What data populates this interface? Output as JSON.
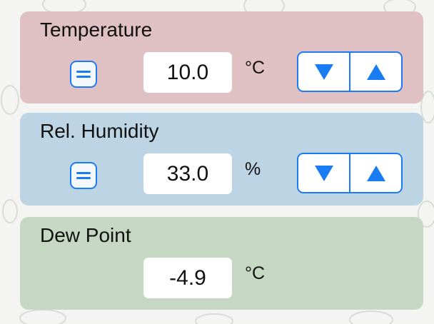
{
  "colors": {
    "temperature_panel": "#dfc0c3",
    "humidity_panel": "#bdd4e4",
    "dew_point_panel": "#c6d8c3",
    "accent": "#1a7cf2"
  },
  "temperature": {
    "title": "Temperature",
    "value": "10.0",
    "unit": "°C",
    "lock_icon": "equals-icon",
    "decrease_icon": "triangle-down-icon",
    "increase_icon": "triangle-up-icon"
  },
  "humidity": {
    "title": "Rel. Humidity",
    "value": "33.0",
    "unit": "%",
    "lock_icon": "equals-icon",
    "decrease_icon": "triangle-down-icon",
    "increase_icon": "triangle-up-icon"
  },
  "dew_point": {
    "title": "Dew Point",
    "value": "-4.9",
    "unit": "°C"
  }
}
